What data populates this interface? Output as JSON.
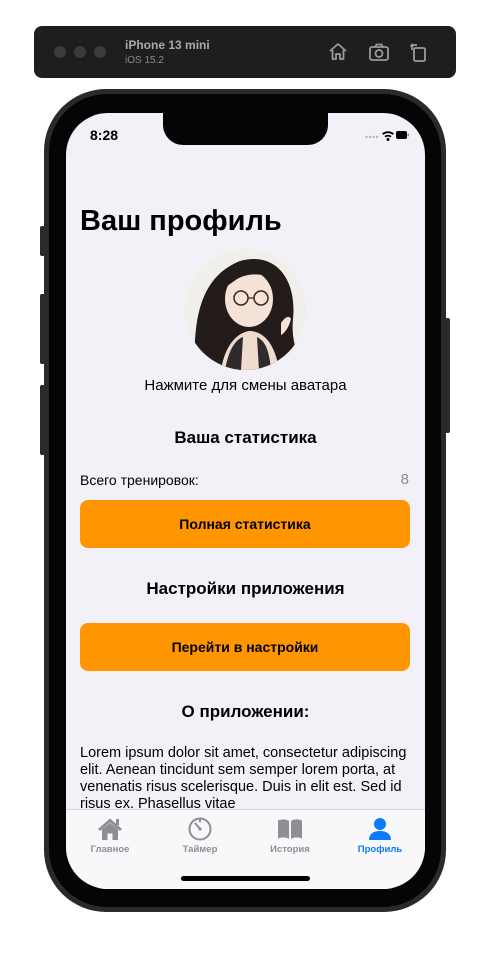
{
  "simulator": {
    "device": "iPhone 13 mini",
    "os": "iOS 15.2"
  },
  "status_bar": {
    "time": "8:28"
  },
  "profile": {
    "title": "Ваш профиль",
    "avatar_hint": "Нажмите для смены аватара"
  },
  "stats": {
    "title": "Ваша статистика",
    "total_label": "Всего тренировок:",
    "total_value": "8",
    "full_stats_button": "Полная статистика"
  },
  "settings": {
    "title": "Настройки приложения",
    "button": "Перейти в настройки"
  },
  "about": {
    "title": "О приложении:",
    "text": "Lorem ipsum dolor sit amet, consectetur adipiscing elit. Aenean tincidunt sem semper lorem porta, at venenatis risus scelerisque. Duis in elit est. Sed id risus ex. Phasellus vitae"
  },
  "tabbar": {
    "items": [
      {
        "label": "Главное",
        "icon": "house-icon",
        "active": false
      },
      {
        "label": "Таймер",
        "icon": "timer-icon",
        "active": false
      },
      {
        "label": "История",
        "icon": "book-icon",
        "active": false
      },
      {
        "label": "Профиль",
        "icon": "person-icon",
        "active": true
      }
    ]
  },
  "colors": {
    "accent_orange": "#ff9500",
    "tab_active": "#0a7aff",
    "tab_inactive": "#8e8e93",
    "background": "#f2f1f7"
  }
}
